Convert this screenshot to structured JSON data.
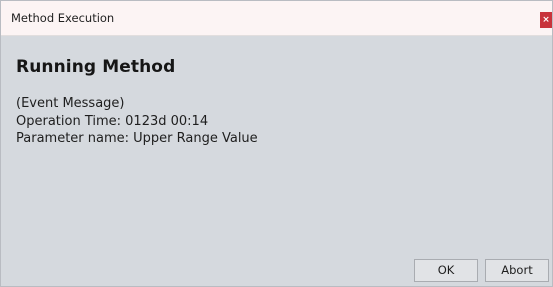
{
  "window": {
    "title": "Method Execution",
    "close_label": "×"
  },
  "content": {
    "heading": "Running Method",
    "lines": [
      "(Event Message)",
      "Operation Time: 0123d 00:14",
      "Parameter name: Upper Range Value"
    ]
  },
  "buttons": {
    "ok_label": "OK",
    "abort_label": "Abort"
  },
  "colors": {
    "background": "#d5d9de",
    "titlebar": "#fcf4f4",
    "close_button": "#c8333b"
  }
}
